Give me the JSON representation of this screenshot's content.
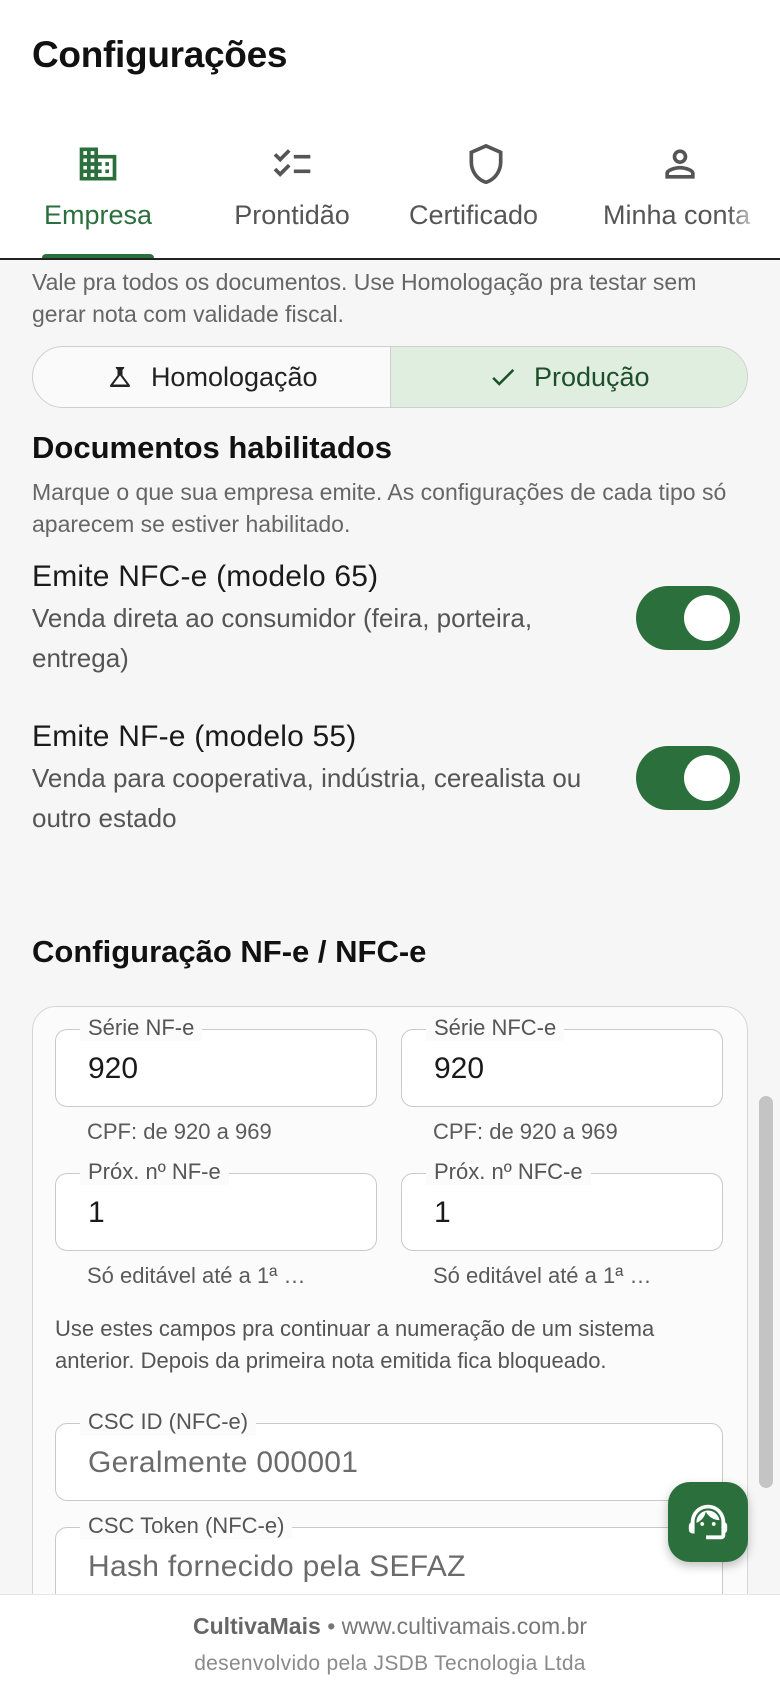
{
  "header": {
    "title": "Configurações",
    "tabs": [
      {
        "label": "Empresa",
        "icon": "building-icon",
        "active": true
      },
      {
        "label": "Prontidão",
        "icon": "checklist-icon",
        "active": false
      },
      {
        "label": "Certificado",
        "icon": "shield-icon",
        "active": false
      },
      {
        "label": "Minha conta",
        "icon": "person-icon",
        "active": false
      }
    ]
  },
  "environment": {
    "description": "Vale pra todos os documentos. Use Homologação pra testar sem gerar nota com validade fiscal.",
    "options": [
      {
        "label": "Homologação",
        "icon": "flask-icon",
        "selected": false
      },
      {
        "label": "Produção",
        "icon": "check-icon",
        "selected": true
      }
    ]
  },
  "documents": {
    "title": "Documentos habilitados",
    "description": "Marque o que sua empresa emite. As configurações de cada tipo só aparecem se estiver habilitado.",
    "items": [
      {
        "title": "Emite NFC-e (modelo 65)",
        "subtitle": "Venda direta ao consumidor (feira, porteira, entrega)",
        "enabled": true
      },
      {
        "title": "Emite NF-e (modelo 55)",
        "subtitle": "Venda para cooperativa, indústria, cerealista ou outro estado",
        "enabled": true
      }
    ]
  },
  "config": {
    "title": "Configuração NF-e / NFC-e",
    "serie_nfe": {
      "label": "Série NF-e",
      "value": "920",
      "helper": "CPF: de 920 a 969"
    },
    "serie_nfce": {
      "label": "Série NFC-e",
      "value": "920",
      "helper": "CPF: de 920 a 969"
    },
    "prox_nfe": {
      "label": "Próx. nº NF-e",
      "value": "1",
      "helper": "Só editável até a 1ª …"
    },
    "prox_nfce": {
      "label": "Próx. nº NFC-e",
      "value": "1",
      "helper": "Só editável até a 1ª …"
    },
    "note": "Use estes campos pra continuar a numeração de um sistema anterior. Depois da primeira nota emitida fica bloqueado.",
    "csc_id": {
      "label": "CSC ID (NFC-e)",
      "placeholder": "Geralmente 000001"
    },
    "csc_token": {
      "label": "CSC Token (NFC-e)",
      "placeholder": "Hash fornecido pela SEFAZ"
    }
  },
  "fab": {
    "icon": "support-agent-icon"
  },
  "footer": {
    "brand": "CultivaMais",
    "separator": "•",
    "url": "www.cultivamais.com.br",
    "credit": "desenvolvido pela JSDB Tecnologia Ltda"
  },
  "colors": {
    "accent": "#2a6f3c",
    "selected_segment": "#dfeedf"
  }
}
